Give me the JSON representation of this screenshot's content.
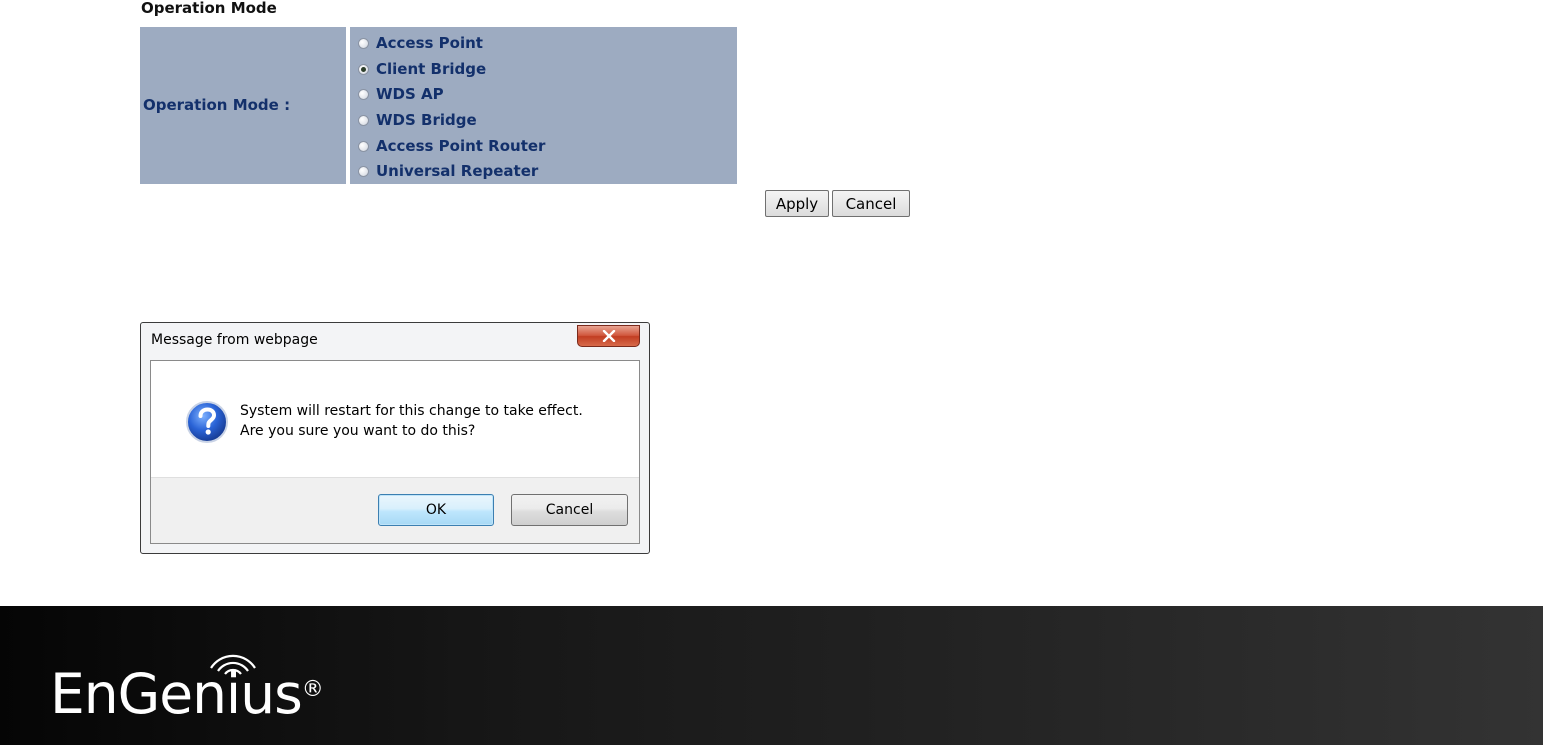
{
  "operation_mode": {
    "section_title": "Operation Mode",
    "label": "Operation Mode :",
    "options": [
      {
        "label": "Access Point",
        "checked": false
      },
      {
        "label": "Client Bridge",
        "checked": true
      },
      {
        "label": "WDS AP",
        "checked": false
      },
      {
        "label": "WDS Bridge",
        "checked": false
      },
      {
        "label": "Access Point Router",
        "checked": false
      },
      {
        "label": "Universal Repeater",
        "checked": false
      }
    ],
    "apply_label": "Apply",
    "cancel_label": "Cancel"
  },
  "dialog": {
    "title": "Message from webpage",
    "close_label": "X",
    "icon": "question-icon",
    "message_line1": "System will restart for this change to take effect.",
    "message_line2": "Are you sure you want to do this?",
    "ok_label": "OK",
    "cancel_label": "Cancel"
  },
  "footer": {
    "logo_text": "EnGenius",
    "logo_mark": "®"
  },
  "colors": {
    "table_bg": "#9dabc1",
    "label_text": "#13306b",
    "close_button": "#c13d22",
    "ok_button_border": "#3c7fb1"
  }
}
